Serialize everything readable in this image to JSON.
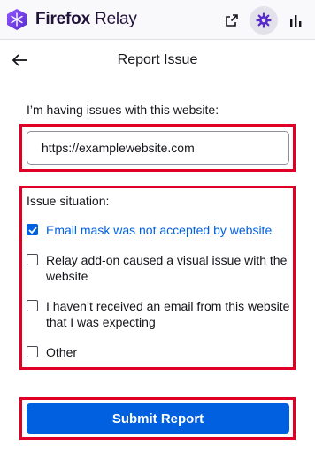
{
  "header": {
    "brand_prefix": "Firefox",
    "brand_suffix": "Relay",
    "icons": [
      "relay-logo-icon",
      "open-external-icon",
      "gear-icon",
      "bar-chart-icon"
    ],
    "accent": "#9059ff"
  },
  "nav": {
    "back_icon": "arrow-left-icon",
    "title": "Report Issue"
  },
  "form": {
    "prompt": "I’m having issues with this website:",
    "website_url": "https://examplewebsite.com",
    "issue_heading": "Issue situation:",
    "options": [
      {
        "label": "Email mask was not accepted by website",
        "checked": true
      },
      {
        "label": "Relay add-on caused a visual issue with the website",
        "checked": false
      },
      {
        "label": "I haven’t received an email from this website that I was expecting",
        "checked": false
      },
      {
        "label": "Other",
        "checked": false
      }
    ],
    "submit_label": "Submit Report",
    "primary_color": "#0060df",
    "highlight_color": "#e00027"
  }
}
